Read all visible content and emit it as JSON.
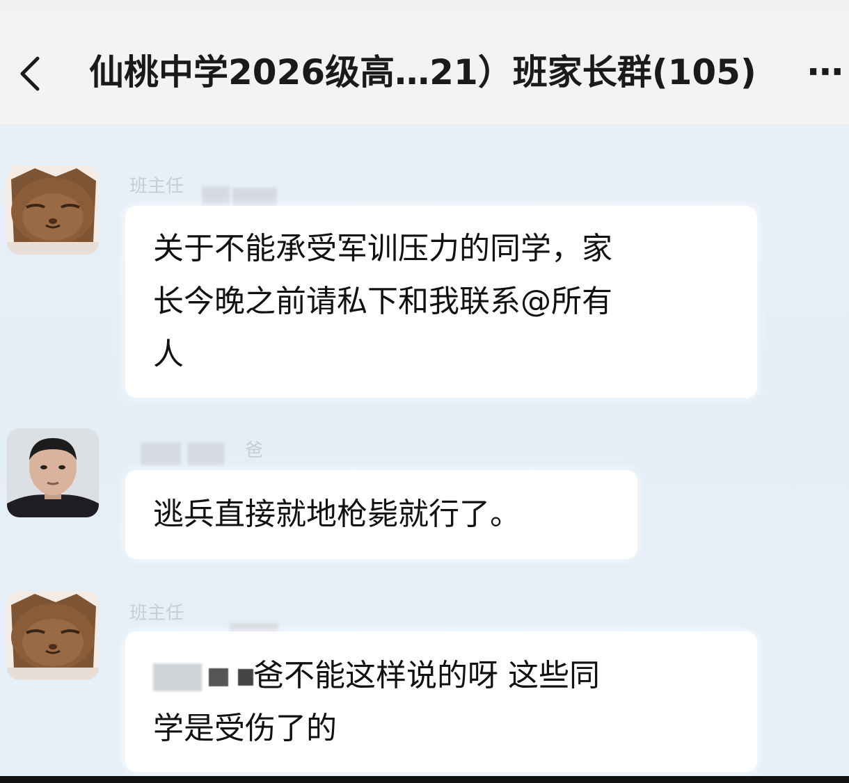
{
  "header": {
    "back_icon": "chevron-left-icon",
    "title": "仙桃中学2026级高…21）班家长群(105)",
    "more_label": "⋯"
  },
  "messages": [
    {
      "sender": "班主任",
      "avatar": "cat-avatar",
      "lines": [
        "关于不能承受军训压力的同学，家",
        "长今晚之前请私下和我联系@所有",
        "人"
      ]
    },
    {
      "sender": "爸",
      "avatar": "man-avatar",
      "lines": [
        "逃兵直接就地枪毙就行了。"
      ]
    },
    {
      "sender": "班主任",
      "avatar": "cat-avatar",
      "lines": [
        "爸不能这样说的呀 这些同",
        "学是受伤了的"
      ]
    }
  ],
  "colors": {
    "header_bg": "#f3f3f3",
    "chat_bg": "#e8f0f7",
    "bubble_bg": "#ffffff",
    "text": "#111111",
    "sender_text": "#c8cdd2"
  }
}
